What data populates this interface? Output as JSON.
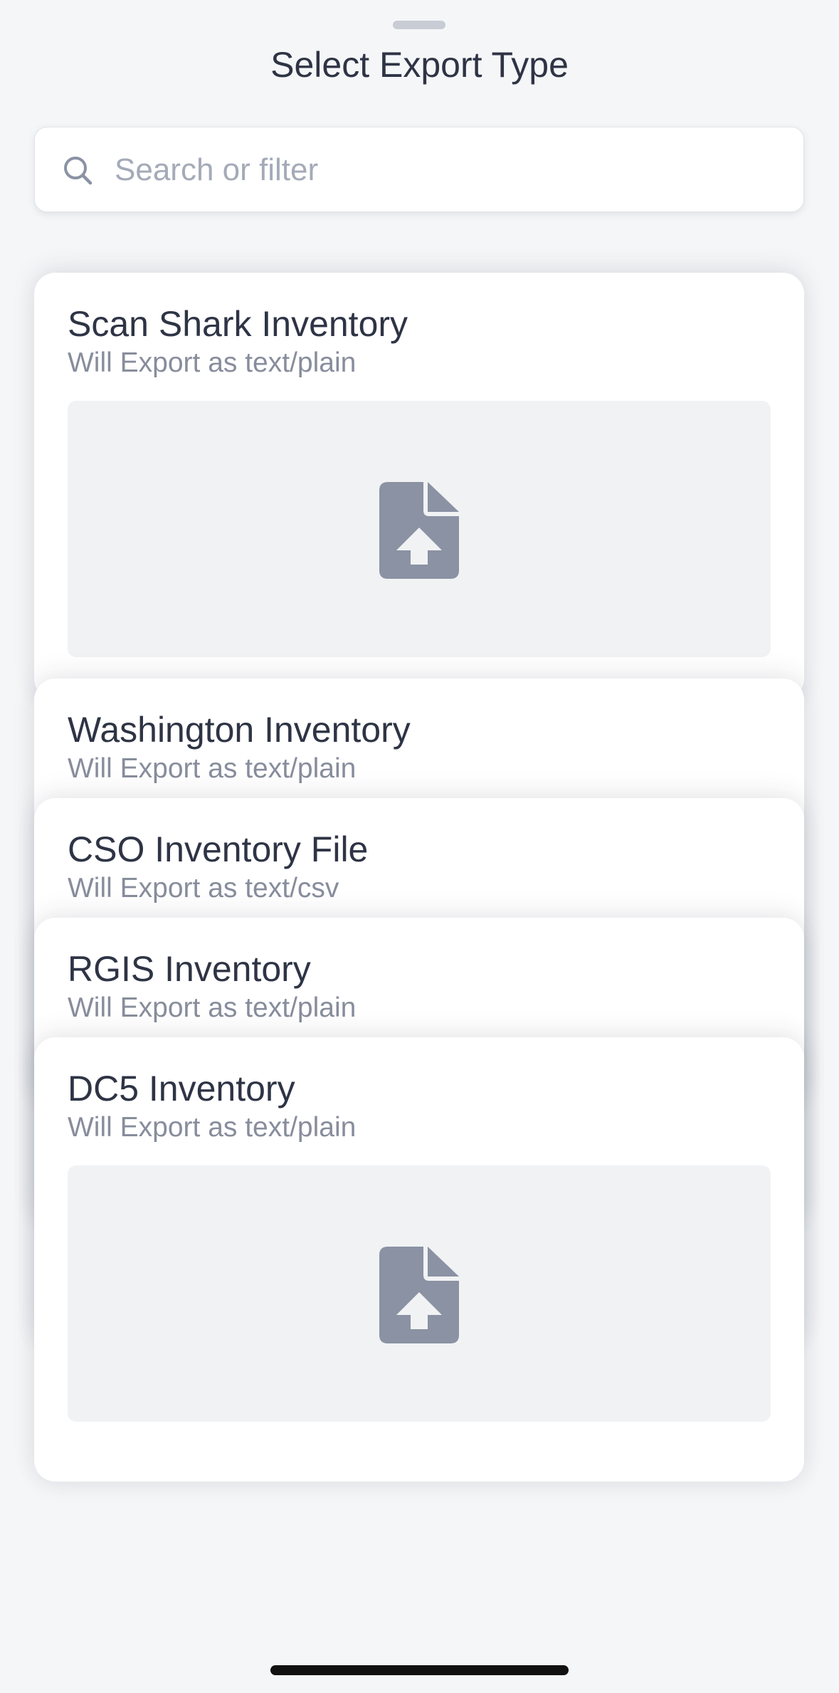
{
  "sheet": {
    "title": "Select Export Type"
  },
  "search": {
    "placeholder": "Search or filter",
    "value": ""
  },
  "export_types": [
    {
      "name": "Scan Shark Inventory",
      "format": "Will Export as text/plain",
      "icon": "file-upload-icon"
    },
    {
      "name": "Washington Inventory",
      "format": "Will Export as text/plain",
      "icon": "file-upload-icon"
    },
    {
      "name": "CSO Inventory File",
      "format": "Will Export as text/csv",
      "icon": "file-upload-icon"
    },
    {
      "name": "RGIS Inventory",
      "format": "Will Export as text/plain",
      "icon": "file-upload-icon"
    },
    {
      "name": "DC5 Inventory",
      "format": "Will Export as text/plain",
      "icon": "file-upload-icon"
    }
  ],
  "colors": {
    "background": "#f5f6f8",
    "card": "#ffffff",
    "preview": "#f1f2f4",
    "icon": "#8a92a3",
    "title_text": "#2e3445",
    "subtitle_text": "#878d9c",
    "placeholder_text": "#a4aab8"
  }
}
